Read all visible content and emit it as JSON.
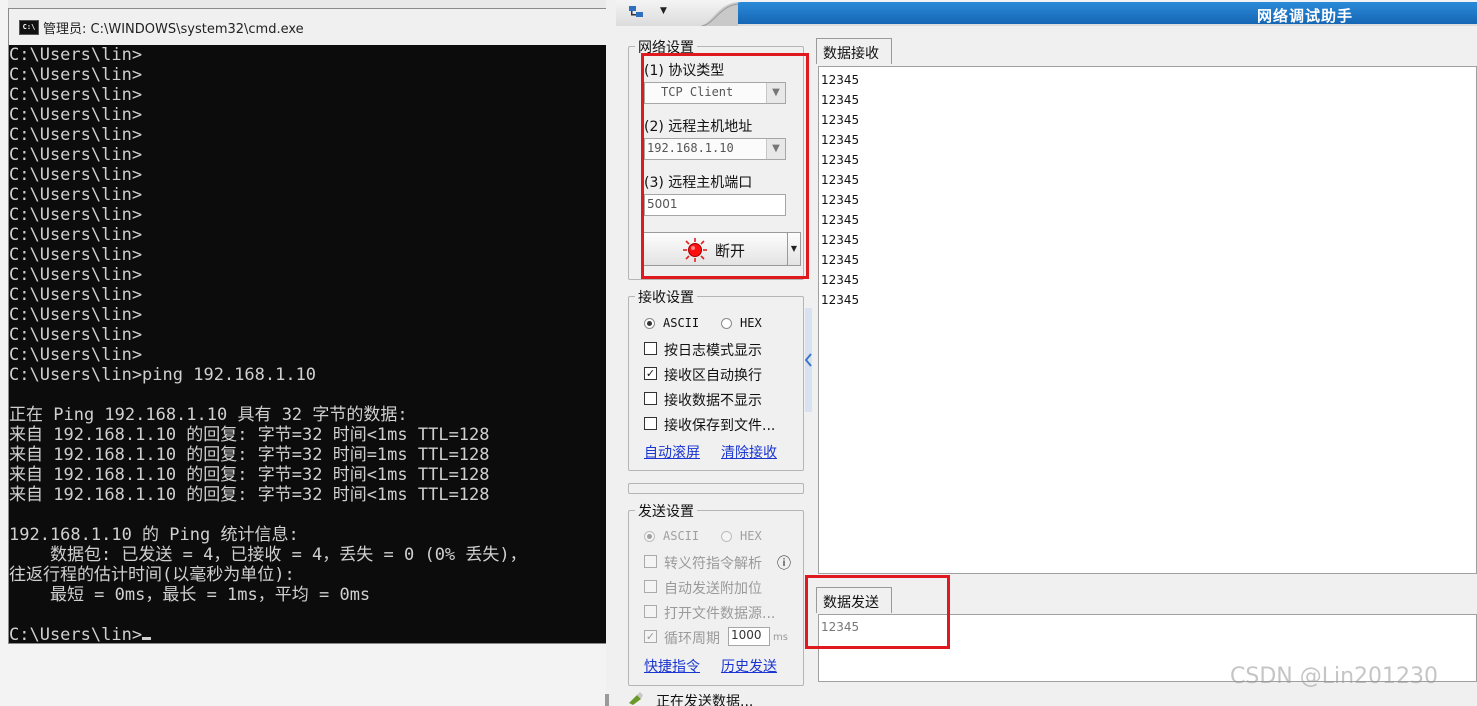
{
  "cmd": {
    "title": "管理员: C:\\WINDOWS\\system32\\cmd.exe",
    "icon_text": "C:\\",
    "lines": [
      "C:\\Users\\lin>",
      "C:\\Users\\lin>",
      "C:\\Users\\lin>",
      "C:\\Users\\lin>",
      "C:\\Users\\lin>",
      "C:\\Users\\lin>",
      "C:\\Users\\lin>",
      "C:\\Users\\lin>",
      "C:\\Users\\lin>",
      "C:\\Users\\lin>",
      "C:\\Users\\lin>",
      "C:\\Users\\lin>",
      "C:\\Users\\lin>",
      "C:\\Users\\lin>",
      "C:\\Users\\lin>",
      "C:\\Users\\lin>",
      "C:\\Users\\lin>ping 192.168.1.10",
      "",
      "正在 Ping 192.168.1.10 具有 32 字节的数据:",
      "来自 192.168.1.10 的回复: 字节=32 时间<1ms TTL=128",
      "来自 192.168.1.10 的回复: 字节=32 时间=1ms TTL=128",
      "来自 192.168.1.10 的回复: 字节=32 时间<1ms TTL=128",
      "来自 192.168.1.10 的回复: 字节=32 时间<1ms TTL=128",
      "",
      "192.168.1.10 的 Ping 统计信息:",
      "    数据包: 已发送 = 4，已接收 = 4，丢失 = 0 (0% 丢失)，",
      "往返行程的估计时间(以毫秒为单位):",
      "    最短 = 0ms，最长 = 1ms，平均 = 0ms",
      "",
      "C:\\Users\\lin>"
    ]
  },
  "net": {
    "title": "网络调试助手",
    "net_settings": {
      "legend": "网络设置",
      "protocol_label": "(1) 协议类型",
      "protocol_value": "TCP Client",
      "remote_ip_label": "(2) 远程主机地址",
      "remote_ip_value": "192.168.1.10",
      "remote_port_label": "(3) 远程主机端口",
      "remote_port_value": "5001",
      "disconnect_label": "断开"
    },
    "recv_settings": {
      "legend": "接收设置",
      "ascii": "ASCII",
      "hex": "HEX",
      "log_mode": "按日志模式显示",
      "auto_wrap": "接收区自动换行",
      "hide_data": "接收数据不显示",
      "save_file": "接收保存到文件...",
      "auto_scroll": "自动滚屏",
      "clear_recv": "清除接收"
    },
    "send_settings": {
      "legend": "发送设置",
      "ascii": "ASCII",
      "hex": "HEX",
      "escape": "转义符指令解析",
      "info_icon": "ⓘ",
      "append_bit": "自动发送附加位",
      "open_file": "打开文件数据源...",
      "cycle": "循环周期",
      "cycle_value": "1000",
      "cycle_unit": "ms",
      "shortcut": "快捷指令",
      "history": "历史发送"
    },
    "recv_tab": "数据接收",
    "send_tab": "数据发送",
    "recv_lines": [
      "12345",
      "12345",
      "12345",
      "12345",
      "12345",
      "12345",
      "12345",
      "12345",
      "12345",
      "12345",
      "12345",
      "12345"
    ],
    "send_text": "12345",
    "status": "正在发送数据..."
  },
  "watermark": "CSDN @Lin201230",
  "colors": {
    "highlight_box": "#e0191e",
    "title_blue": "#1667b5",
    "link": "#1a35d1"
  }
}
